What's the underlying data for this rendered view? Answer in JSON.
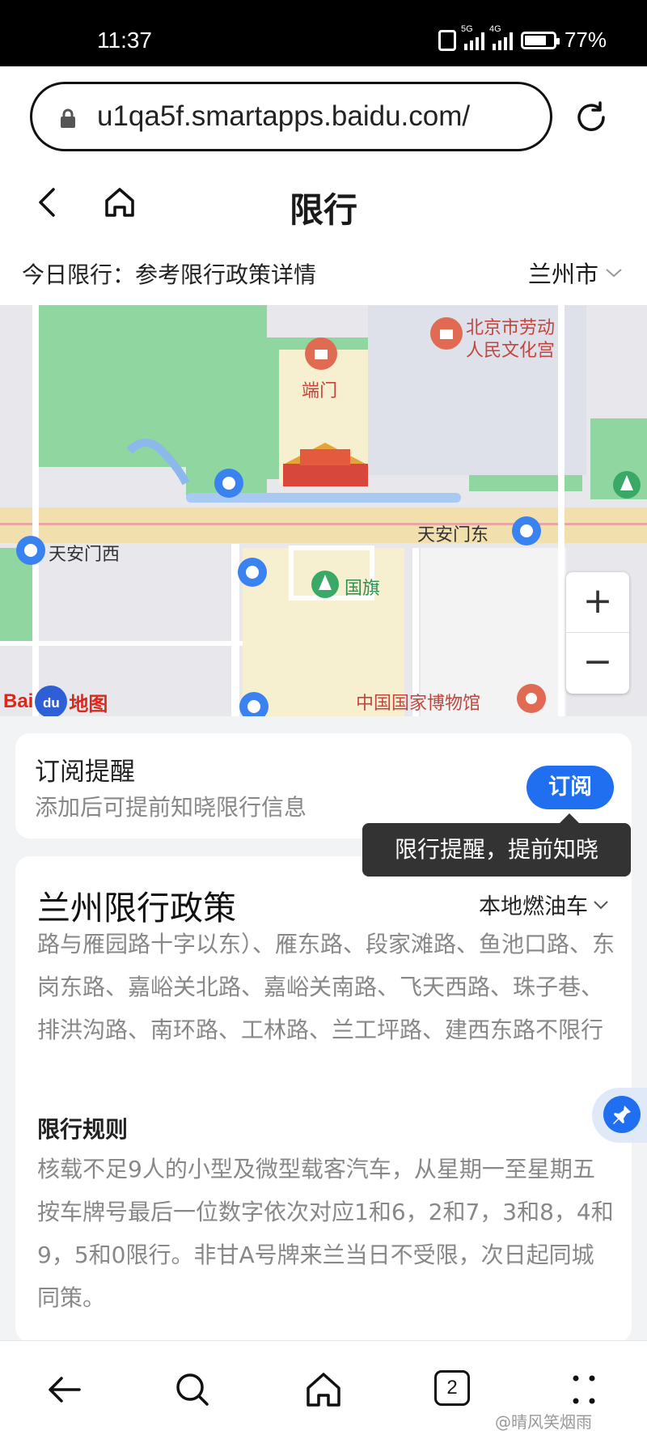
{
  "status_bar": {
    "time": "11:37",
    "net1": "5G",
    "net2": "4G",
    "battery": "77%",
    "battery_level": 0.77
  },
  "browser": {
    "url": "u1qa5f.smartapps.baidu.com/"
  },
  "header": {
    "title": "限行"
  },
  "info_row": {
    "today_text": "今日限行：参考限行政策详情",
    "city": "兰州市"
  },
  "map": {
    "pois": {
      "duanmen": "端门",
      "labor_palace_line1": "北京市劳动",
      "labor_palace_line2": "人民文化宫",
      "tam_east": "天安门东",
      "tam_west": "天安门西",
      "flag": "国旗",
      "museum": "中国国家博物馆"
    },
    "logo": {
      "bai": "Bai",
      "du": "du",
      "ditu": "地图"
    },
    "zoom_in": "+",
    "zoom_out": "−"
  },
  "subscribe": {
    "title": "订阅提醒",
    "desc": "添加后可提前知晓限行信息",
    "button": "订阅",
    "tooltip": "限行提醒，提前知晓"
  },
  "policy": {
    "title": "兰州限行政策",
    "vehicle_type": "本地燃油车",
    "roads_text": "路与雁园路十字以东）、雁东路、段家滩路、鱼池口路、东岗东路、嘉峪关北路、嘉峪关南路、飞天西路、珠子巷、排洪沟路、南环路、工林路、兰工坪路、建西东路不限行",
    "rule_title": "限行规则",
    "rule_text": "核载不足9人的小型及微型载客汽车，从星期一至星期五按车牌号最后一位数字依次对应1和6，2和7，3和8，4和9，5和0限行。非甘A号牌来兰当日不受限，次日起同城同策。"
  },
  "bottom_nav": {
    "tab_count": "2",
    "watermark": "@晴风笑烟雨"
  },
  "colors": {
    "accent": "#1f6ff0",
    "map_green": "#8fd6a0",
    "map_yellow": "#f6f0d0"
  }
}
